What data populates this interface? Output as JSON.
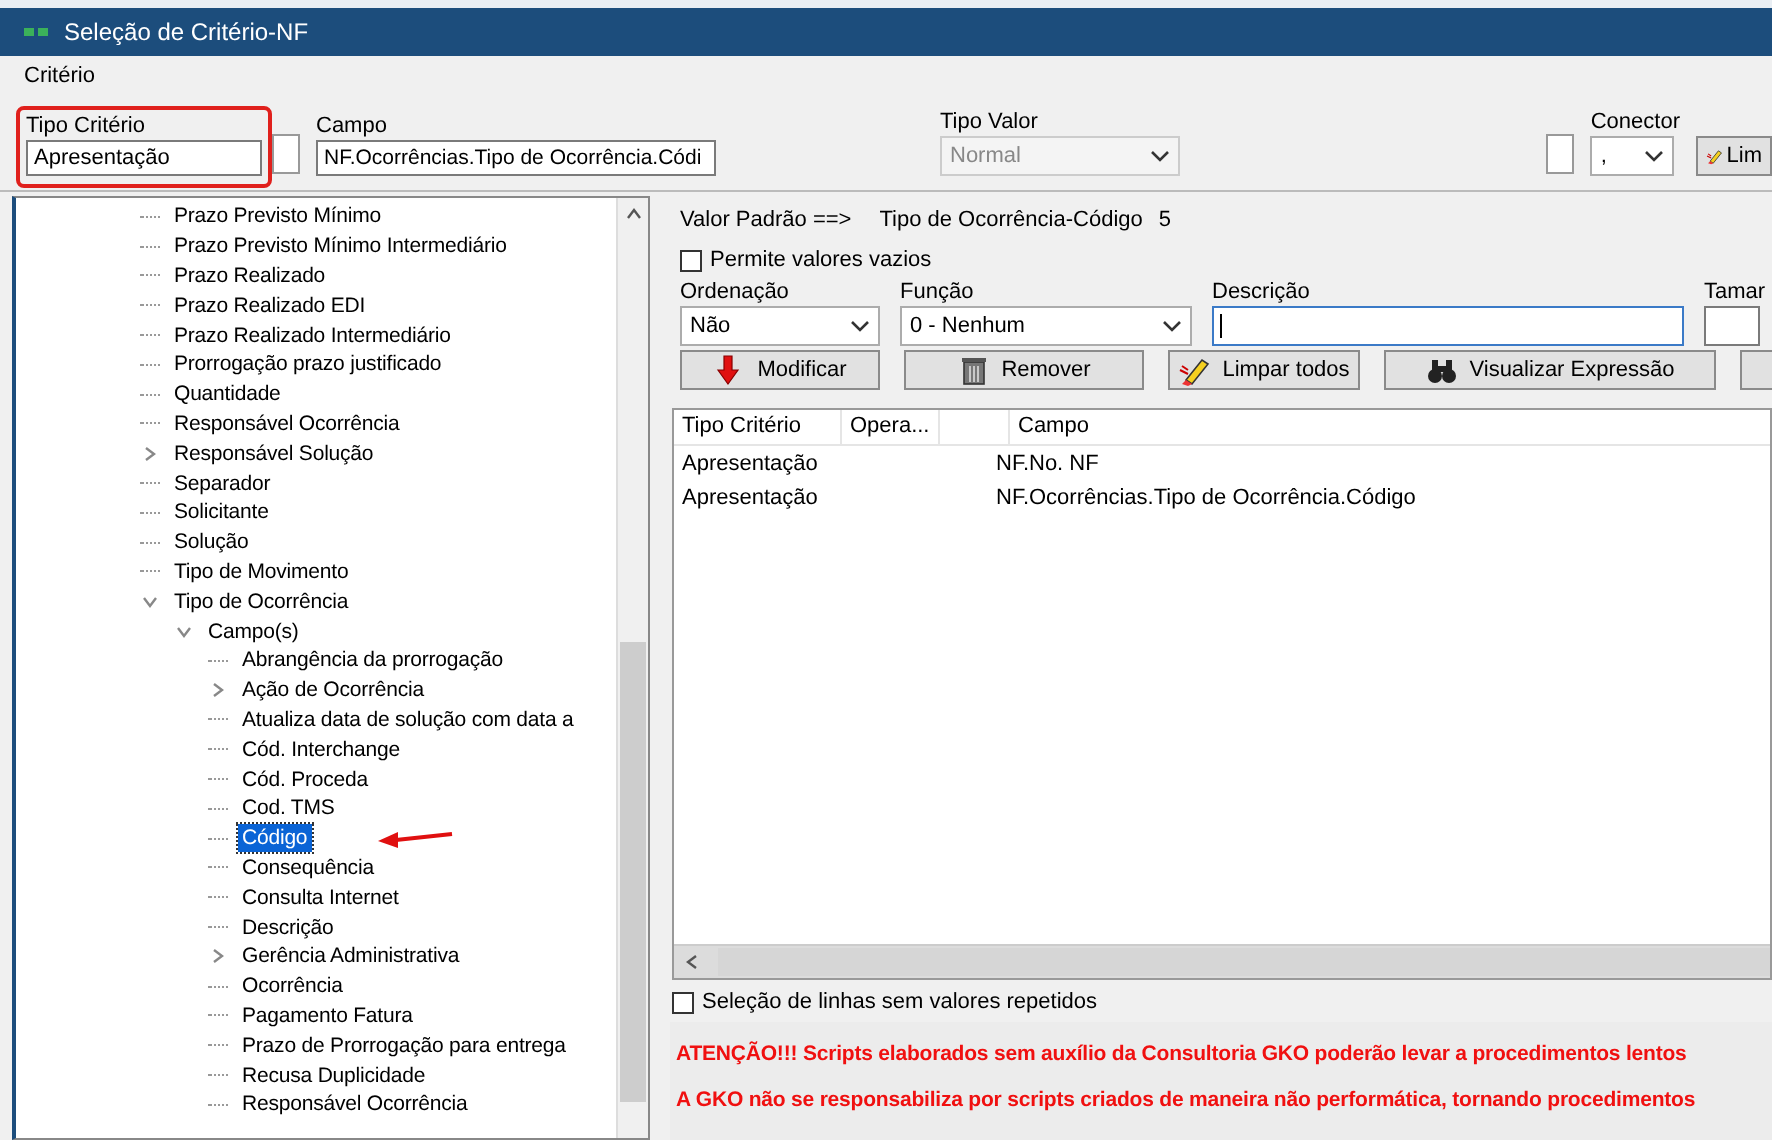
{
  "window": {
    "title": "Seleção de Critério-NF"
  },
  "menu": [
    {
      "label": "Critério"
    }
  ],
  "criteria_bar": {
    "tipo_criterio": {
      "label": "Tipo Critério",
      "value": "Apresentação",
      "highlighted": true
    },
    "checkbox_1": {
      "checked": false
    },
    "campo": {
      "label": "Campo",
      "value": "NF.Ocorrências.Tipo de Ocorrência.Códi"
    },
    "tipo_valor": {
      "label": "Tipo Valor",
      "value": "Normal",
      "disabled": true
    },
    "checkbox_2": {
      "checked": false
    },
    "conector": {
      "label": "Conector",
      "value": ","
    },
    "limpar_button": {
      "label": "Lim"
    }
  },
  "tree": [
    {
      "label": "Prazo Previsto Mínimo",
      "selected": false
    },
    {
      "label": "Prazo Previsto Mínimo Intermediário",
      "selected": false
    },
    {
      "label": "Prazo Realizado",
      "selected": false
    },
    {
      "label": "Prazo Realizado EDI",
      "selected": false
    },
    {
      "label": "Prazo Realizado Intermediário",
      "selected": false
    },
    {
      "label": "Prorrogação prazo justificado",
      "selected": false
    },
    {
      "label": "Quantidade",
      "selected": false
    },
    {
      "label": "Responsável Ocorrência",
      "selected": false
    },
    {
      "label": "Responsável Solução",
      "selected": false,
      "expanded": false
    },
    {
      "label": "Separador",
      "selected": false
    },
    {
      "label": "Solicitante",
      "selected": false
    },
    {
      "label": "Solução",
      "selected": false
    },
    {
      "label": "Tipo de Movimento",
      "selected": false
    },
    {
      "label": "Tipo de Ocorrência",
      "selected": false,
      "expanded": true,
      "children": [
        {
          "label": "Campo(s)",
          "selected": false,
          "expanded": true,
          "children": [
            {
              "label": "Abrangência da prorrogação",
              "selected": false
            },
            {
              "label": "Ação de Ocorrência",
              "selected": false,
              "expanded": false
            },
            {
              "label": "Atualiza data de solução com data a",
              "selected": false
            },
            {
              "label": "Cód. Interchange",
              "selected": false
            },
            {
              "label": "Cód. Proceda",
              "selected": false
            },
            {
              "label": "Cod. TMS",
              "selected": false
            },
            {
              "label": "Código",
              "selected": true
            },
            {
              "label": "Consequência",
              "selected": false
            },
            {
              "label": "Consulta Internet",
              "selected": false
            },
            {
              "label": "Descrição",
              "selected": false
            },
            {
              "label": "Gerência Administrativa",
              "selected": false,
              "expanded": false
            },
            {
              "label": "Ocorrência",
              "selected": false
            },
            {
              "label": "Pagamento Fatura",
              "selected": false
            },
            {
              "label": "Prazo de Prorrogação para entrega",
              "selected": false
            },
            {
              "label": "Recusa Duplicidade",
              "selected": false
            },
            {
              "label": "Responsável Ocorrência",
              "selected": false
            }
          ]
        }
      ]
    }
  ],
  "default_value": {
    "label": "Valor Padrão ==>",
    "field": "Tipo de Ocorrência-Código",
    "value": "5"
  },
  "allow_empty": {
    "label": "Permite valores vazios",
    "checked": false
  },
  "fields": [
    {
      "label": "Ordenação",
      "value": "Não",
      "kind": "combo"
    },
    {
      "label": "Função",
      "value": "0 - Nenhum",
      "kind": "combo"
    },
    {
      "label": "Descrição",
      "kind": "text",
      "focused": true
    },
    {
      "label": "Tamar",
      "kind": "text",
      "focused": false
    }
  ],
  "buttons": [
    {
      "label": "Modificar",
      "kind": "arrow"
    },
    {
      "label": "Remover",
      "kind": "trash"
    },
    {
      "label": "Limpar todos",
      "kind": "eraser"
    },
    {
      "label": "Visualizar Expressão",
      "kind": "binoculars"
    },
    {
      "kind": "cut"
    }
  ],
  "table": {
    "columns": [
      {
        "label": "Tipo Critério"
      },
      {
        "label": "Opera..."
      },
      {
        "kind": "blank"
      },
      {
        "label": "Campo"
      }
    ],
    "rows": [
      {
        "tipo_criterio": "Apresentação",
        "campo": "NF.No. NF"
      },
      {
        "tipo_criterio": "Apresentação",
        "campo": "NF.Ocorrências.Tipo de Ocorrência.Código"
      }
    ]
  },
  "unique_rows": {
    "label": "Seleção de linhas sem valores repetidos",
    "checked": false
  },
  "warnings": [
    "ATENÇÃO!!! Scripts elaborados sem auxílio da Consultoria GKO poderão levar a procedimentos lentos",
    "A GKO não se responsabiliza por scripts criados de maneira não performática, tornando procedimentos"
  ],
  "annotation": {
    "arrow_to_selected": true
  }
}
